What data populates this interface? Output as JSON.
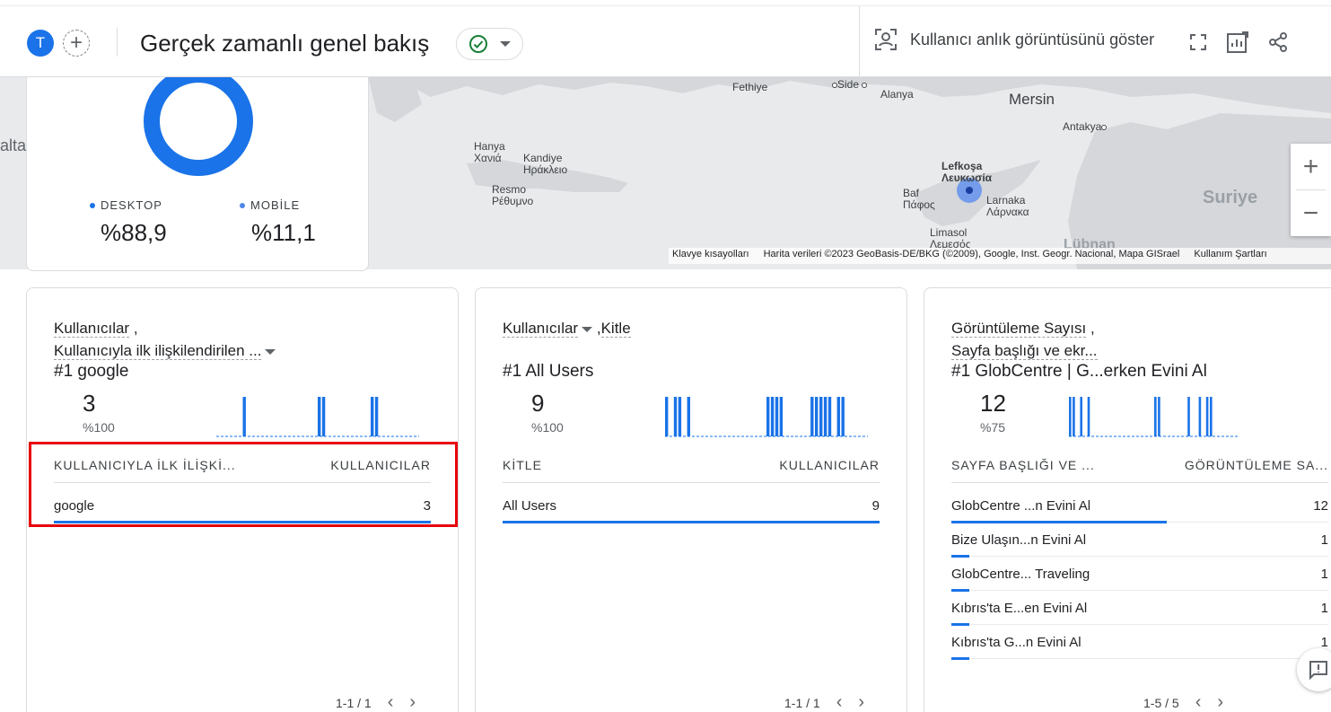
{
  "header": {
    "avatar_letter": "T",
    "add_comparison": "+",
    "title": "Gerçek zamanlı genel bakış",
    "snapshot_label": "Kullanıcı anlık görüntüsünü göster"
  },
  "device_card": {
    "left_edge_text": "alta",
    "legend": [
      {
        "label": "DESKTOP",
        "value": "%88,9",
        "color": "#1a73e8",
        "share": 0.889
      },
      {
        "label": "MOBİLE",
        "value": "%11,1",
        "color": "#4f86e8",
        "share": 0.111
      }
    ]
  },
  "map": {
    "cities": {
      "fethiye": "Fethiye",
      "side": "Side",
      "alanya": "Alanya",
      "mersin": "Mersin",
      "antakya": "Antakya",
      "hanya": "Hanya",
      "hanya_gr": "Χανιά",
      "kandiye": "Kandiye",
      "kandiye_gr": "Ηράκλειο",
      "resmo": "Resmo",
      "resmo_gr": "Ρέθυμνο",
      "lefkosa": "Lefkoşa",
      "lefkosa_gr": "Λευκωσία",
      "baf": "Baf",
      "baf_gr": "Πάφος",
      "larnaka": "Larnaka",
      "larnaka_gr": "Λάρνακα",
      "limasol": "Limasol",
      "limasol_gr": "Λεμεσός",
      "suriye": "Suriye",
      "lubnan": "Lübnan"
    },
    "footer": {
      "shortcuts": "Klavye kısayolları",
      "attribution": "Harita verileri ©2023 GeoBasis-DE/BKG (©2009), Google, Inst. Geogr. Nacional, Mapa GISrael",
      "terms": "Kullanım Şartları"
    },
    "zoom_in": "+",
    "zoom_out": "−"
  },
  "cards": [
    {
      "title_metric": "Kullanıcılar",
      "title_sep": ",",
      "title_dimension": "Kullanıcıyla ilk ilişkilendirilen ...",
      "top_item": "#1  google",
      "total": "3",
      "pct": "%100",
      "spark": [
        0,
        0,
        0,
        0,
        0,
        0,
        1,
        0,
        0,
        0,
        0,
        0,
        0,
        0,
        0,
        0,
        0,
        0,
        0,
        0,
        0,
        0,
        0,
        1,
        1,
        0,
        0,
        0,
        0,
        0,
        0,
        0,
        0,
        0,
        0,
        1,
        1,
        0,
        0,
        0,
        0,
        0,
        0,
        0,
        0,
        0
      ],
      "col_dim": "KULLANICIYLA İLK İLİŞKİ...",
      "col_metric": "KULLANICILAR",
      "rows": [
        {
          "label": "google",
          "value": "3",
          "fill": 1.0
        }
      ],
      "pager": "1-1 / 1"
    },
    {
      "title_metric": "Kullanıcılar",
      "title_sep": ",",
      "title_dimension": "Kitle",
      "top_item": "#1  All Users",
      "total": "9",
      "pct": "%100",
      "spark": [
        1,
        0,
        1,
        1,
        0,
        1,
        0,
        0,
        0,
        0,
        0,
        0,
        0,
        0,
        0,
        0,
        0,
        0,
        0,
        0,
        0,
        0,
        0,
        1,
        1,
        1,
        1,
        0,
        0,
        0,
        0,
        0,
        0,
        1,
        1,
        1,
        1,
        1,
        0,
        1,
        1,
        0,
        0,
        0,
        0,
        0
      ],
      "col_dim": "KİTLE",
      "col_metric": "KULLANICILAR",
      "rows": [
        {
          "label": "All Users",
          "value": "9",
          "fill": 1.0
        }
      ],
      "pager": "1-1 / 1"
    },
    {
      "title_metric": "Görüntüleme Sayısı",
      "title_sep": ",",
      "title_dimension": "Sayfa başlığı ve ekr...",
      "top_item": "#1  GlobCentre | G...erken Evini Al",
      "total": "12",
      "pct": "%75",
      "spark": [
        1,
        1,
        0,
        1,
        0,
        1,
        0,
        0,
        0,
        0,
        0,
        0,
        0,
        0,
        0,
        0,
        0,
        0,
        0,
        0,
        0,
        0,
        0,
        1,
        1,
        0,
        0,
        0,
        0,
        0,
        0,
        0,
        1,
        0,
        0,
        1,
        0,
        1,
        1,
        0,
        0,
        0,
        0,
        0,
        0,
        0
      ],
      "col_dim": "SAYFA BAŞLIĞI VE ...",
      "col_metric": "GÖRÜNTÜLEME SA...",
      "rows": [
        {
          "label": "GlobCentre ...n Evini Al",
          "value": "12",
          "fill": 0.571
        },
        {
          "label": "Bize Ulaşın...n Evini Al",
          "value": "1",
          "fill": 0.048
        },
        {
          "label": "GlobCentre... Traveling",
          "value": "1",
          "fill": 0.048
        },
        {
          "label": "Kıbrıs'ta E...en Evini Al",
          "value": "1",
          "fill": 0.048
        },
        {
          "label": "Kıbrıs'ta G...n Evini Al",
          "value": "1",
          "fill": 0.048
        }
      ],
      "pager": "1-5 / 5"
    }
  ]
}
